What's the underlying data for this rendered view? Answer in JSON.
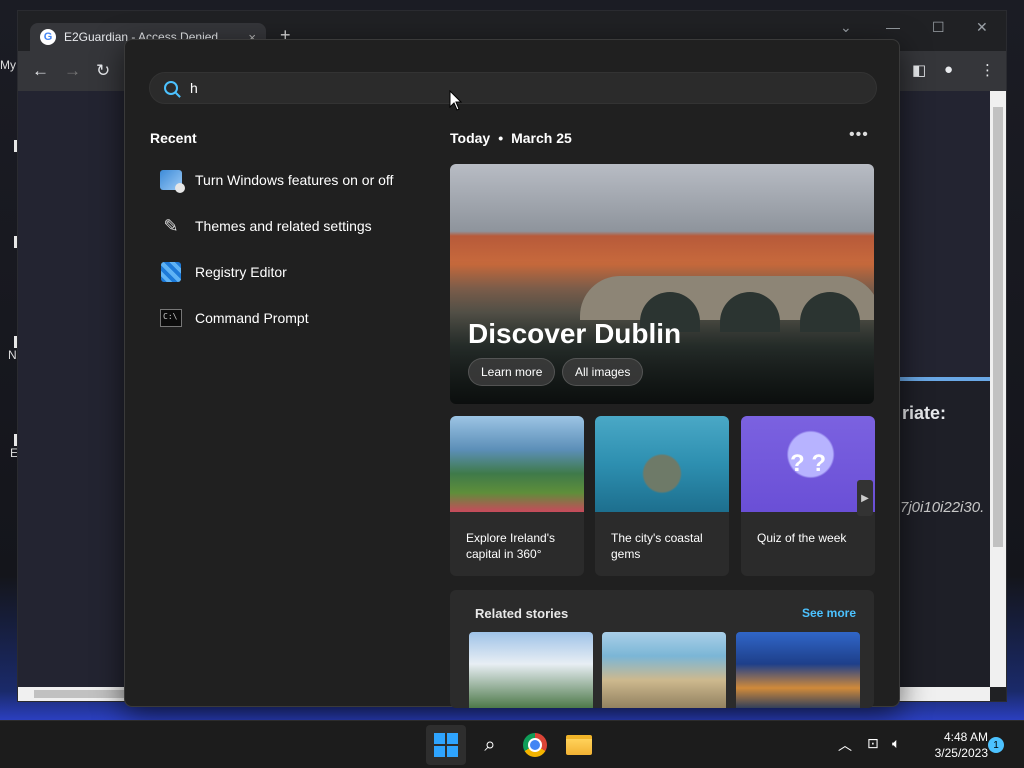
{
  "browser": {
    "tab_title": "E2Guardian - Access Denied",
    "tab_close": "×",
    "new_tab": "+",
    "page_heading_partial": "riate:",
    "page_code_partial": "7j0i10i22i30."
  },
  "desktop": {
    "icon_labels": [
      "My",
      "N",
      "E"
    ]
  },
  "search": {
    "query": "h"
  },
  "recent": {
    "heading": "Recent",
    "items": [
      {
        "label": "Turn Windows features on or off",
        "icon": "windows-features-icon"
      },
      {
        "label": "Themes and related settings",
        "icon": "paintbrush-icon"
      },
      {
        "label": "Registry Editor",
        "icon": "registry-editor-icon"
      },
      {
        "label": "Command Prompt",
        "icon": "command-prompt-icon"
      }
    ]
  },
  "today": {
    "label": "Today",
    "separator": "•",
    "date": "March 25",
    "more": "•••"
  },
  "hero": {
    "title": "Discover Dublin",
    "learn_more": "Learn more",
    "all_images": "All images"
  },
  "cards": [
    {
      "caption": "Explore Ireland's capital in 360°"
    },
    {
      "caption": "The city's coastal gems"
    },
    {
      "caption": "Quiz of the week"
    }
  ],
  "related": {
    "heading": "Related stories",
    "see_more": "See more"
  },
  "taskbar": {
    "time": "4:48 AM",
    "date": "3/25/2023",
    "notification_count": "1"
  }
}
